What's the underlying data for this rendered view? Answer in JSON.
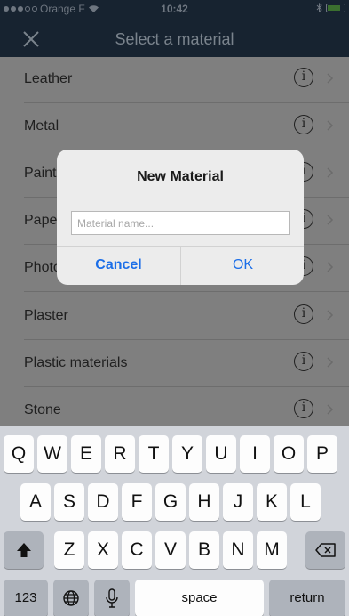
{
  "status_bar": {
    "carrier": "Orange F",
    "time": "10:42"
  },
  "nav": {
    "title": "Select a material"
  },
  "materials": [
    "Leather",
    "Metal",
    "Paint",
    "Paper",
    "Photo",
    "Plaster",
    "Plastic materials",
    "Stone"
  ],
  "dialog": {
    "title": "New Material",
    "placeholder": "Material name...",
    "cancel": "Cancel",
    "ok": "OK"
  },
  "keyboard": {
    "row1": [
      "Q",
      "W",
      "E",
      "R",
      "T",
      "Y",
      "U",
      "I",
      "O",
      "P"
    ],
    "row2": [
      "A",
      "S",
      "D",
      "F",
      "G",
      "H",
      "J",
      "K",
      "L"
    ],
    "row3": [
      "Z",
      "X",
      "C",
      "V",
      "B",
      "N",
      "M"
    ],
    "numbers_key": "123",
    "space_key": "space",
    "return_key": "return"
  },
  "colors": {
    "accent": "#1b6ee8",
    "nav_bg": "#172330"
  },
  "icons": {
    "close": "close-icon",
    "info": "info-icon",
    "chevron": "chevron-right-icon",
    "shift": "shift-icon",
    "backspace": "backspace-icon",
    "globe": "globe-icon",
    "mic": "microphone-icon"
  }
}
